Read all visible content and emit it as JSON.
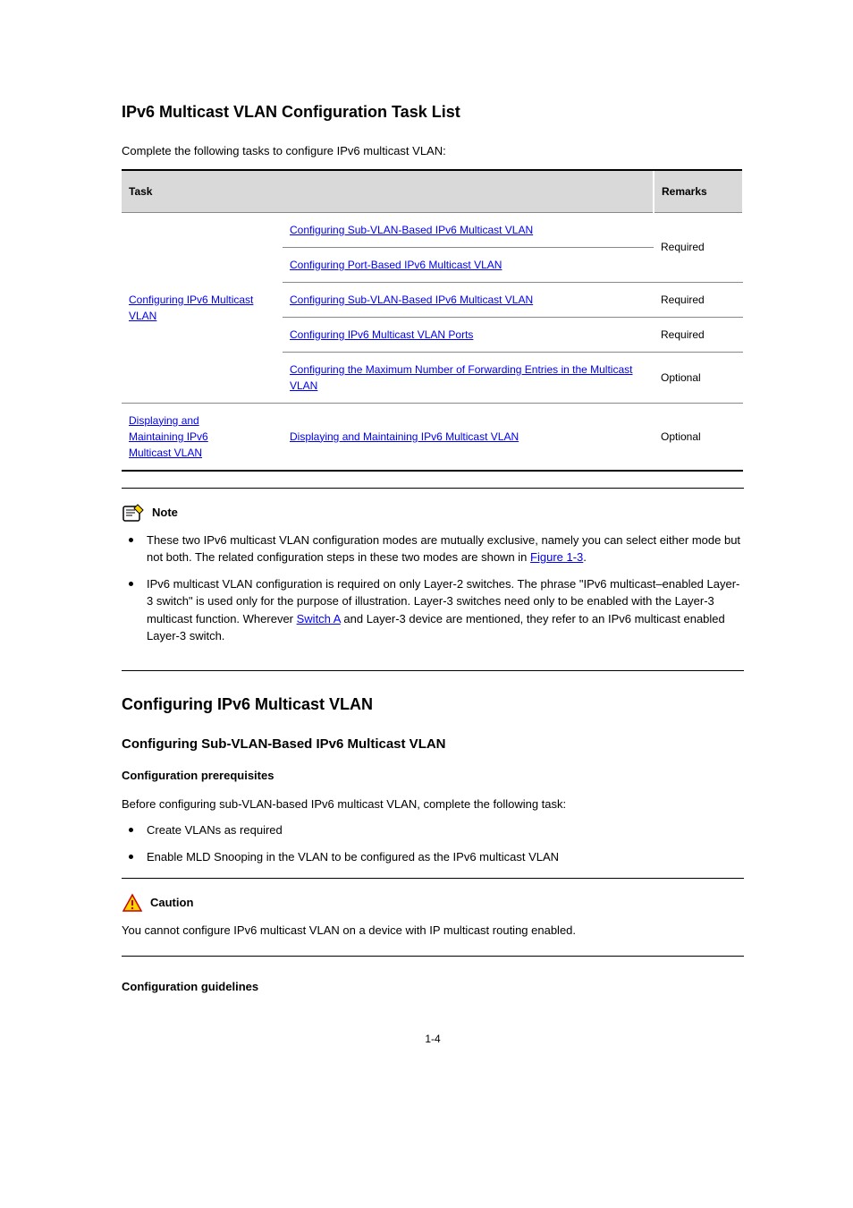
{
  "heading_main": "IPv6 Multicast VLAN Configuration Task List",
  "table_caption": "Complete the following tasks to configure IPv6 multicast VLAN:",
  "table": {
    "headers": [
      "Task",
      "Remarks"
    ],
    "group1_label": "Configuring IPv6 Multicast VLAN",
    "group1_rows": [
      {
        "label": "Configuring Sub-VLAN-Based IPv6 Multicast VLAN",
        "remark": "Required"
      },
      {
        "label": "Configuring Port-Based IPv6 Multicast VLAN",
        "remark": ""
      }
    ],
    "group2_rows": [
      {
        "label": "Configuring Sub-VLAN-Based IPv6 Multicast VLAN",
        "remark": "Required"
      },
      {
        "label": "Configuring IPv6 Multicast VLAN Ports",
        "remark": "Required"
      },
      {
        "label": "Configuring the Maximum Number of Forwarding Entries in the Multicast VLAN",
        "remark": "Optional"
      }
    ],
    "group3_label_line1": "Displaying and",
    "group3_label_line2": "Maintaining IPv6",
    "group3_label_line3": "Multicast VLAN",
    "group3_task": "Displaying and Maintaining IPv6 Multicast VLAN",
    "group3_remark": "Optional"
  },
  "note": {
    "label": "Note",
    "items": [
      {
        "prefix": "These two IPv6 multicast VLAN configuration modes are mutually exclusive, namely you can select either mode but not both. The related configuration steps in these two modes are shown in ",
        "link": "Figure 1-3",
        "suffix": "."
      },
      {
        "prefix": "IPv6 multicast VLAN configuration is required on only Layer-2 switches. The phrase \"IPv6 multicast–enabled Layer-3 switch\" is used only for the purpose of illustration. Layer-3 switches need only to be enabled with the Layer-3 multicast function. Wherever ",
        "link": "Switch A",
        "suffix": " and Layer-3 device are mentioned, they refer to an IPv6 multicast enabled Layer-3 switch."
      }
    ]
  },
  "section_config": {
    "heading": "Configuring IPv6 Multicast VLAN",
    "sub_heading": "Configuring Sub-VLAN-Based IPv6 Multicast VLAN",
    "config_prereq_heading": "Configuration prerequisites",
    "config_prereq_intro": "Before configuring sub-VLAN-based IPv6 multicast VLAN, complete the following task:",
    "prereq_items": [
      "Create VLANs as required",
      "Enable MLD Snooping in the VLAN to be configured as the IPv6 multicast VLAN"
    ]
  },
  "caution": {
    "label": "Caution",
    "text": "You cannot configure IPv6 multicast VLAN on a device with IP multicast routing enabled."
  },
  "config_guidelines_heading": "Configuration guidelines",
  "page_number": "1-4"
}
